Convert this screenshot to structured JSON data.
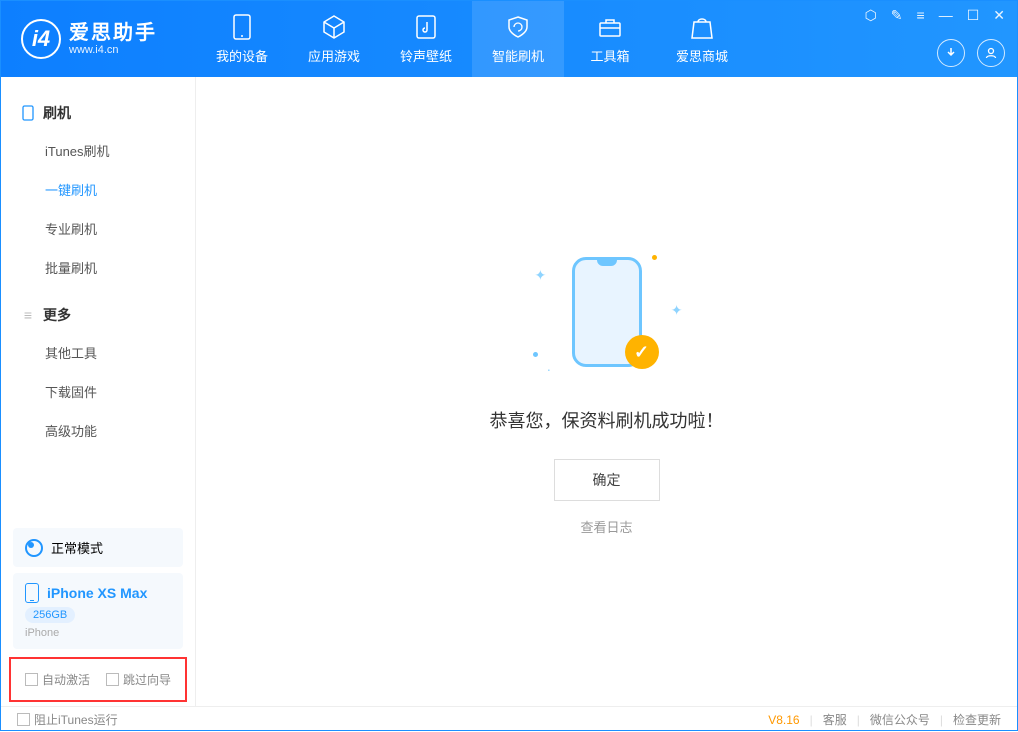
{
  "app": {
    "title": "爱思助手",
    "subtitle": "www.i4.cn"
  },
  "nav": {
    "tabs": [
      {
        "label": "我的设备"
      },
      {
        "label": "应用游戏"
      },
      {
        "label": "铃声壁纸"
      },
      {
        "label": "智能刷机"
      },
      {
        "label": "工具箱"
      },
      {
        "label": "爱思商城"
      }
    ]
  },
  "sidebar": {
    "section1": {
      "title": "刷机",
      "items": [
        "iTunes刷机",
        "一键刷机",
        "专业刷机",
        "批量刷机"
      ],
      "active_index": 1
    },
    "section2": {
      "title": "更多",
      "items": [
        "其他工具",
        "下载固件",
        "高级功能"
      ]
    },
    "mode": "正常模式",
    "device": {
      "name": "iPhone XS Max",
      "storage": "256GB",
      "type": "iPhone"
    },
    "checks": {
      "auto_activate": "自动激活",
      "skip_guide": "跳过向导"
    }
  },
  "main": {
    "success_text": "恭喜您，保资料刷机成功啦！",
    "confirm": "确定",
    "view_log": "查看日志"
  },
  "footer": {
    "block_itunes": "阻止iTunes运行",
    "version": "V8.16",
    "links": [
      "客服",
      "微信公众号",
      "检查更新"
    ]
  }
}
